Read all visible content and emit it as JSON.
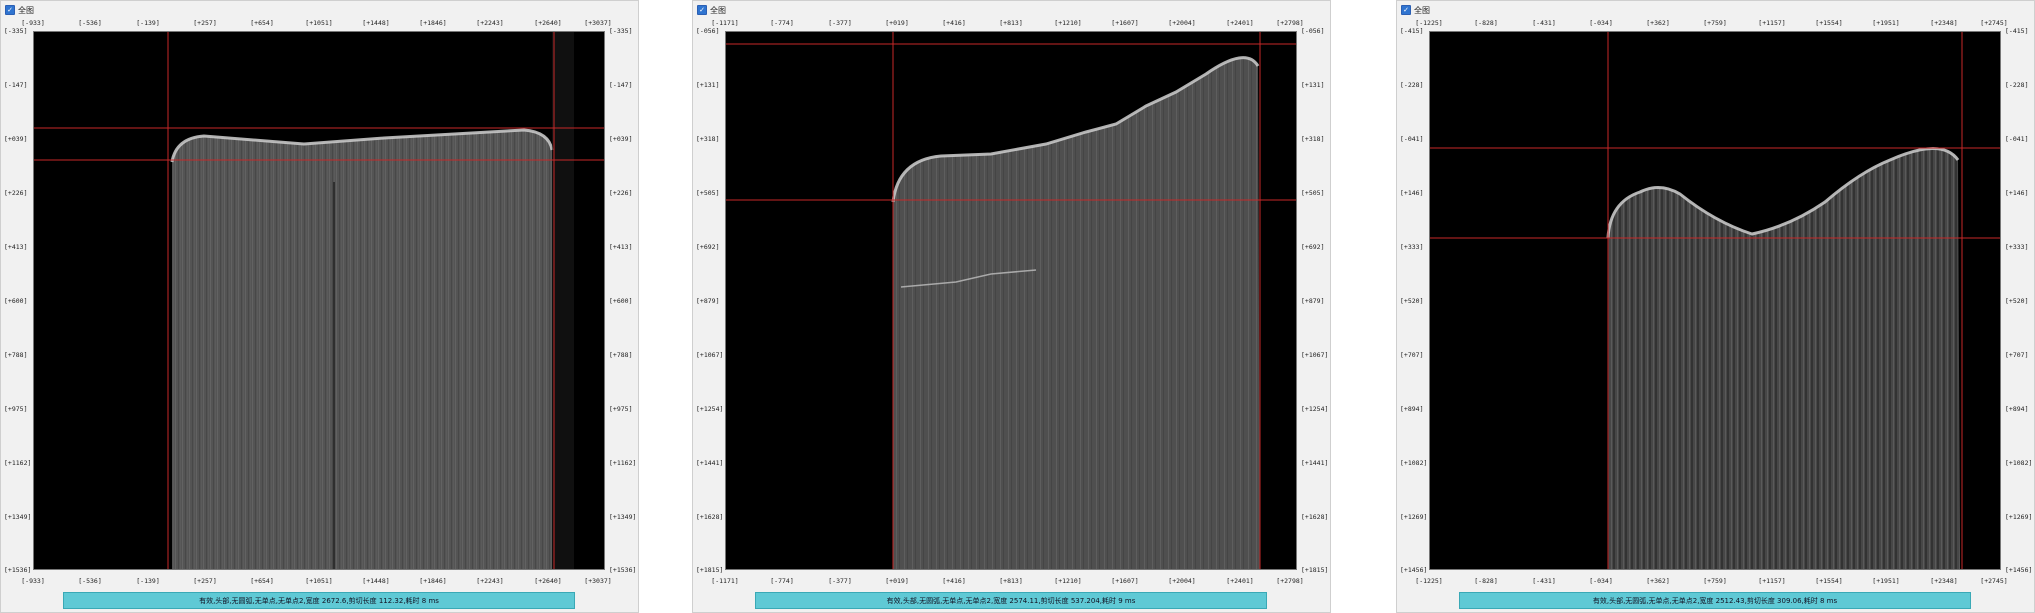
{
  "panels": [
    {
      "checkbox_label": "全图",
      "x_ticks": [
        "[-933]",
        "[-536]",
        "[-139]",
        "[+257]",
        "[+654]",
        "[+1051]",
        "[+1448]",
        "[+1846]",
        "[+2243]",
        "[+2640]",
        "[+3037]"
      ],
      "y_ticks": [
        "[-335]",
        "[-147]",
        "[+039]",
        "[+226]",
        "[+413]",
        "[+600]",
        "[+788]",
        "[+975]",
        "[+1162]",
        "[+1349]",
        "[+1536]"
      ],
      "status": "有效,头部,无圆弧,无单点,无单点2,宽度 2672.6,剪切长度 112.32,耗时 8 ms"
    },
    {
      "checkbox_label": "全图",
      "x_ticks": [
        "[-1171]",
        "[-774]",
        "[-377]",
        "[+019]",
        "[+416]",
        "[+813]",
        "[+1210]",
        "[+1607]",
        "[+2004]",
        "[+2401]",
        "[+2798]"
      ],
      "y_ticks": [
        "[-056]",
        "[+131]",
        "[+318]",
        "[+505]",
        "[+692]",
        "[+879]",
        "[+1067]",
        "[+1254]",
        "[+1441]",
        "[+1628]",
        "[+1815]"
      ],
      "status": "有效,头部,无圆弧,无单点,无单点2,宽度 2574.11,剪切长度 537.204,耗时 9 ms"
    },
    {
      "checkbox_label": "全图",
      "x_ticks": [
        "[-1225]",
        "[-828]",
        "[-431]",
        "[-034]",
        "[+362]",
        "[+759]",
        "[+1157]",
        "[+1554]",
        "[+1951]",
        "[+2348]",
        "[+2745]"
      ],
      "y_ticks": [
        "[-415]",
        "[-228]",
        "[-041]",
        "[+146]",
        "[+333]",
        "[+520]",
        "[+707]",
        "[+894]",
        "[+1082]",
        "[+1269]",
        "[+1456]"
      ],
      "status": "有效,头部,无圆弧,无单点,无单点2,宽度 2512.43,剪切长度 309.06,耗时 8 ms"
    }
  ],
  "colors": {
    "panel_bg": "#f1f1f1",
    "status_bg": "#5fc9d5",
    "guide_line": "#c62828",
    "checkbox": "#2f74d0"
  }
}
